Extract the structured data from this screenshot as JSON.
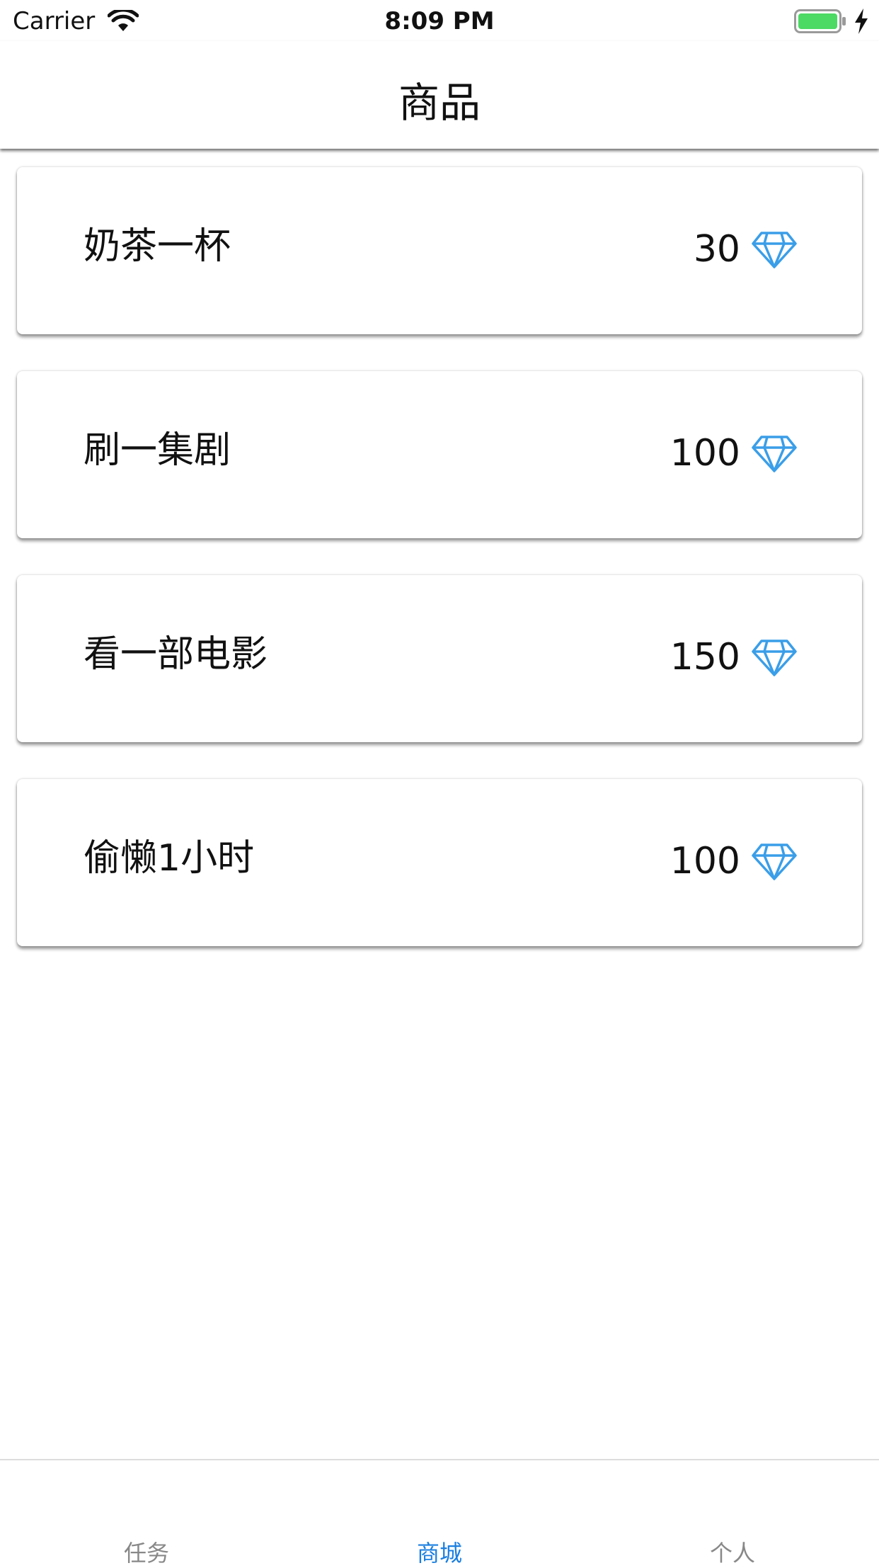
{
  "status_bar": {
    "carrier": "Carrier",
    "time": "8:09 PM"
  },
  "nav": {
    "title": "商品"
  },
  "products": [
    {
      "name": "奶茶一杯",
      "price": "30"
    },
    {
      "name": "刷一集剧",
      "price": "100"
    },
    {
      "name": "看一部电影",
      "price": "150"
    },
    {
      "name": "偷懒1小时",
      "price": "100"
    }
  ],
  "tabs": [
    {
      "label": "任务",
      "active": false
    },
    {
      "label": "商城",
      "active": true
    },
    {
      "label": "个人",
      "active": false
    }
  ],
  "colors": {
    "accent": "#1a7fe0",
    "diamond": "#3a9ee8",
    "battery": "#4cd964",
    "tab_inactive": "#888888"
  },
  "icons": {
    "price": "diamond-icon",
    "signal": "wifi-icon",
    "battery": "battery-icon",
    "charging": "charging-bolt-icon"
  }
}
